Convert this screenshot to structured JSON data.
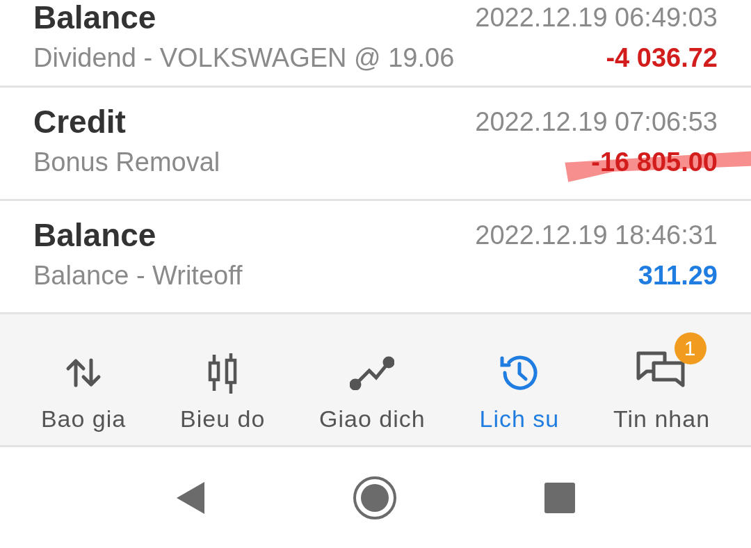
{
  "transactions": [
    {
      "type": "Balance",
      "time": "2022.12.19 06:49:03",
      "comment": "Dividend - VOLKSWAGEN @ 19.06",
      "amount": "-4 036.72",
      "negative": true,
      "highlighted": false
    },
    {
      "type": "Credit",
      "time": "2022.12.19 07:06:53",
      "comment": "Bonus Removal",
      "amount": "-16 805.00",
      "negative": true,
      "highlighted": true
    },
    {
      "type": "Balance",
      "time": "2022.12.19 18:46:31",
      "comment": "Balance - Writeoff",
      "amount": "311.29",
      "negative": false,
      "highlighted": false
    }
  ],
  "nav_tabs": [
    {
      "kind": "quotes",
      "label": "Bao gia",
      "selected": false
    },
    {
      "kind": "chart",
      "label": "Bieu do",
      "selected": false
    },
    {
      "kind": "trade",
      "label": "Giao dich",
      "selected": false
    },
    {
      "kind": "history",
      "label": "Lich su",
      "selected": true
    },
    {
      "kind": "messages",
      "label": "Tin nhan",
      "selected": false,
      "badge": "1"
    }
  ]
}
